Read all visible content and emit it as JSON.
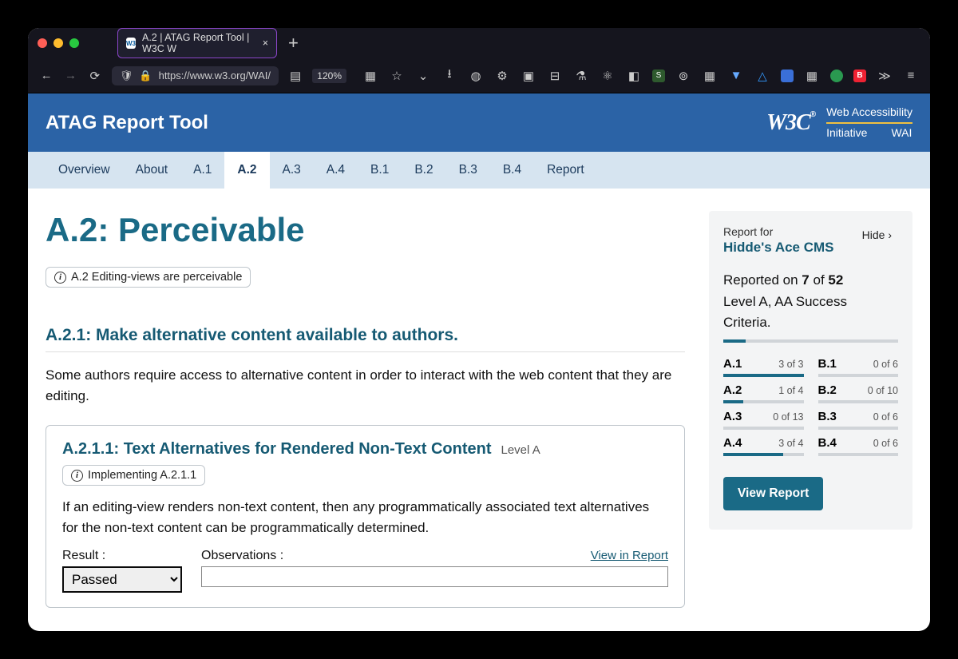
{
  "browser": {
    "tab_title": "A.2 | ATAG Report Tool | W3C W",
    "url_display": "https://www.w3.org/WAI/",
    "zoom": "120%",
    "traffic": {
      "red": "#ff5f57",
      "yellow": "#febc2e",
      "green": "#28c840"
    }
  },
  "header": {
    "title": "ATAG Report Tool",
    "w3c": "W3C",
    "wai_line1": "Web Accessibility",
    "wai_line2a": "Initiative",
    "wai_line2b": "WAI"
  },
  "nav": {
    "items": [
      "Overview",
      "About",
      "A.1",
      "A.2",
      "A.3",
      "A.4",
      "B.1",
      "B.2",
      "B.3",
      "B.4",
      "Report"
    ],
    "active_index": 3
  },
  "page": {
    "h1": "A.2: Perceivable",
    "chip": "A.2 Editing-views are perceivable",
    "h2": "A.2.1: Make alternative content available to authors.",
    "desc": "Some authors require access to alternative content in order to interact with the web content that they are editing.",
    "criterion": {
      "title": "A.2.1.1: Text Alternatives for Rendered Non-Text Content",
      "level": "Level A",
      "implChip": "Implementing A.2.1.1",
      "body": "If an editing-view renders non-text content, then any programmatically associated text alternatives for the non-text content can be programmatically determined.",
      "result_label": "Result :",
      "result_value": "Passed",
      "obs_label": "Observations :",
      "view_link": "View in Report"
    }
  },
  "panel": {
    "hide": "Hide",
    "report_for": "Report for",
    "project": "Hidde's Ace CMS",
    "reported_prefix": "Reported on ",
    "done": "7",
    "of": " of ",
    "total": "52",
    "line2": "Level A, AA Success Criteria.",
    "overall_pct": 13,
    "items": [
      {
        "id": "A.1",
        "done": 3,
        "total": 3
      },
      {
        "id": "B.1",
        "done": 0,
        "total": 6
      },
      {
        "id": "A.2",
        "done": 1,
        "total": 4
      },
      {
        "id": "B.2",
        "done": 0,
        "total": 10
      },
      {
        "id": "A.3",
        "done": 0,
        "total": 13
      },
      {
        "id": "B.3",
        "done": 0,
        "total": 6
      },
      {
        "id": "A.4",
        "done": 3,
        "total": 4
      },
      {
        "id": "B.4",
        "done": 0,
        "total": 6
      }
    ],
    "view_button": "View Report"
  }
}
